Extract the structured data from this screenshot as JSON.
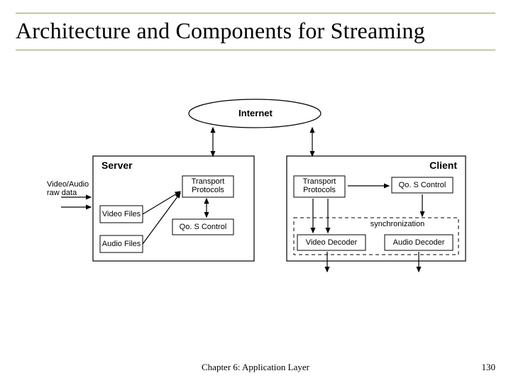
{
  "title": "Architecture and Components for Streaming",
  "internet": "Internet",
  "server": {
    "label": "Server",
    "input": "Video/Audio\nraw data",
    "video_files": "Video Files",
    "audio_files": "Audio Files",
    "transport": "Transport\nProtocols",
    "qos": "Qo. S Control"
  },
  "client": {
    "label": "Client",
    "transport": "Transport\nProtocols",
    "qos": "Qo. S Control",
    "sync": "synchronization",
    "video_decoder": "Video Decoder",
    "audio_decoder": "Audio Decoder"
  },
  "footer": "Chapter 6: Application Layer",
  "page": "130"
}
